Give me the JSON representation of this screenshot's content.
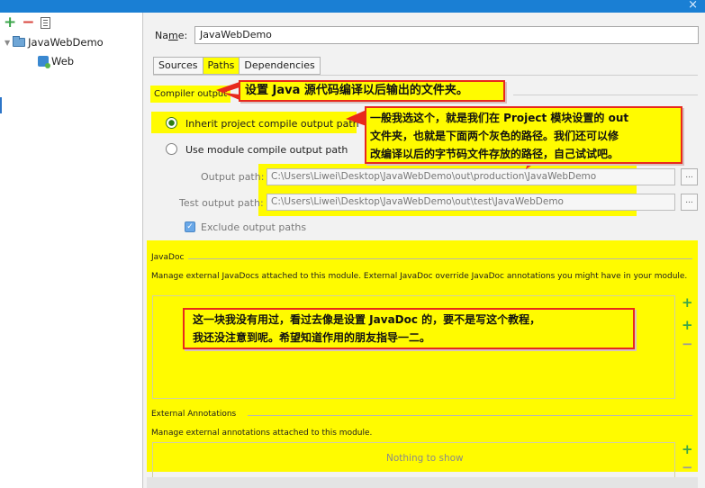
{
  "window": {
    "close_glyph": "×"
  },
  "left_toolbar": {
    "add": "+",
    "remove": "−"
  },
  "tree": [
    {
      "label": "JavaWebDemo",
      "chevron": "▼"
    },
    {
      "label": "Web"
    }
  ],
  "name_field": {
    "label_prefix": "Na",
    "label_underline": "m",
    "label_suffix": "e:",
    "value": "JavaWebDemo"
  },
  "tabs": [
    {
      "label": "Sources"
    },
    {
      "label": "Paths",
      "active": true
    },
    {
      "label": "Dependencies"
    }
  ],
  "compiler_output": {
    "section_label": "Compiler output",
    "inherit_label": "Inherit project compile output path",
    "use_module_label": "Use module compile output path",
    "output_path_label": "Output path:",
    "output_path_value": "C:\\Users\\Liwei\\Desktop\\JavaWebDemo\\out\\production\\JavaWebDemo",
    "test_output_path_label": "Test output path:",
    "test_output_path_value": "C:\\Users\\Liwei\\Desktop\\JavaWebDemo\\out\\test\\JavaWebDemo",
    "browse": "...",
    "exclude_label": "Exclude output paths"
  },
  "javadoc": {
    "title": "JavaDoc",
    "description": "Manage external JavaDocs attached to this module. External JavaDoc override JavaDoc annotations you might have in your module.",
    "add": "+",
    "add_url": "+",
    "remove": "−"
  },
  "external_annotations": {
    "title": "External Annotations",
    "description": "Manage external annotations attached to this module.",
    "empty_text": "Nothing to show",
    "add": "+",
    "remove": "−"
  },
  "callouts": {
    "c1": "设置 Java 源代码编译以后输出的文件夹。",
    "c2_lines": [
      "一般我选这个，就是我们在 Project 模块设置的 out",
      "文件夹，也就是下面两个灰色的路径。我们还可以修",
      "改编译以后的字节码文件存放的路径，自己试试吧。"
    ],
    "c3_lines": [
      "这一块我没有用过，看过去像是设置 JavaDoc 的，要不是写这个教程，",
      "我还没注意到呢。希望知道作用的朋友指导一二。"
    ]
  },
  "colors": {
    "highlight": "#fffb00",
    "callout_border": "#e8291c",
    "arrow": "#e8291c",
    "title_bar": "#1a7fd4",
    "add_green": "#3ba54a",
    "remove_red": "#d9433b"
  }
}
